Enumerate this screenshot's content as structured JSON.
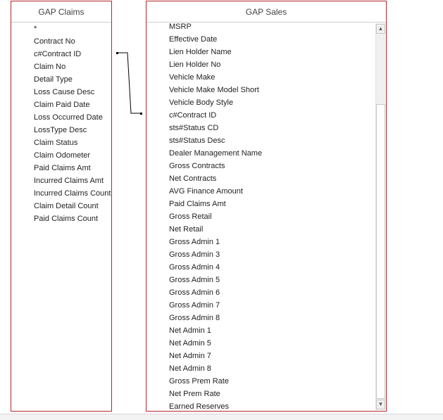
{
  "tables": {
    "claims": {
      "title": "GAP Claims",
      "fields": [
        "*",
        "Contract No",
        "c#Contract ID",
        "Claim No",
        "Detail Type",
        "Loss Cause Desc",
        "Claim Paid Date",
        "Loss Occurred Date",
        "LossType Desc",
        "Claim Status",
        "Claim Odometer",
        "Paid Claims Amt",
        "Incurred Claims Amt",
        "Incurred Claims Count",
        "Claim Detail Count",
        "Paid Claims Count"
      ]
    },
    "sales": {
      "title": "GAP Sales",
      "fields": [
        "MSRP",
        "Effective Date",
        "Lien Holder Name",
        "Lien Holder No",
        "Vehicle Make",
        "Vehicle Make Model Short",
        "Vehicle Body Style",
        "c#Contract ID",
        "sts#Status CD",
        "sts#Status Desc",
        "Dealer Management Name",
        "Gross Contracts",
        "Net Contracts",
        "AVG Finance Amount",
        "Paid Claims Amt",
        "Gross Retail",
        "Net Retail",
        "Gross Admin 1",
        "Gross Admin 3",
        "Gross Admin 4",
        "Gross Admin 5",
        "Gross Admin 6",
        "Gross Admin 7",
        "Gross Admin 8",
        "Net Admin 1",
        "Net Admin 5",
        "Net Admin 7",
        "Net Admin 8",
        "Gross Prem Rate",
        "Net Prem Rate",
        "Earned Reserves"
      ]
    }
  },
  "scrollbar": {
    "up_icon": "scroll-up-arrow-icon",
    "down_icon": "scroll-down-arrow-icon"
  },
  "relationship": {
    "from_field": "c#Contract ID",
    "to_field": "c#Contract ID"
  },
  "colors": {
    "table_border": "#b3272d",
    "join_line": "#000000"
  }
}
